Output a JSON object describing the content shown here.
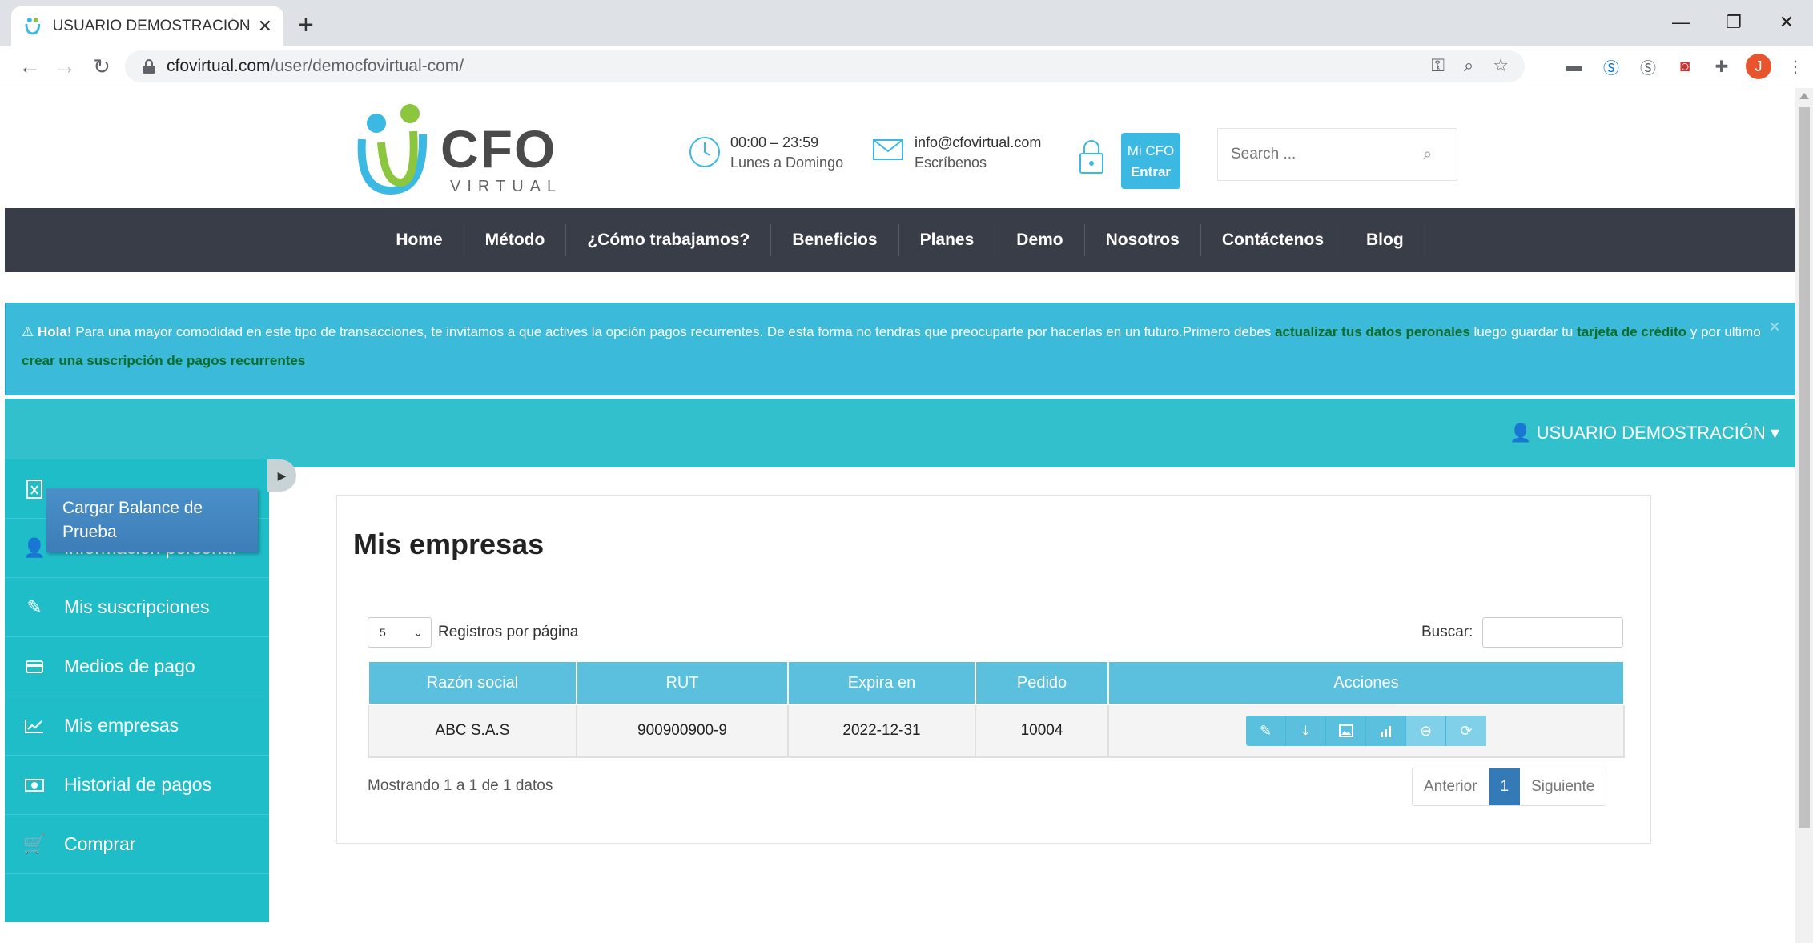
{
  "browser": {
    "tab_title": "USUARIO DEMOSTRACIÓN | CFO",
    "new_tab": "+",
    "url_host": "cfovirtual.com",
    "url_path": "/user/democfovirtual-com/",
    "avatar_letter": "J"
  },
  "site": {
    "logo_text": "CFO",
    "logo_sub": "VIRTUAL",
    "hours": "00:00 – 23:59",
    "days": "Lunes a Domingo",
    "email": "info@cfovirtual.com",
    "email_sub": "Escríbenos",
    "mi_cfo_line1": "Mi CFO",
    "mi_cfo_line2": "Entrar",
    "search_placeholder": "Search ..."
  },
  "nav": [
    "Home",
    "Método",
    "¿Cómo trabajamos?",
    "Beneficios",
    "Planes",
    "Demo",
    "Nosotros",
    "Contáctenos",
    "Blog"
  ],
  "alert": {
    "bold": "Hola!",
    "text1": "Para una mayor comodidad en este tipo de transacciones, te invitamos a que actives la opción pagos recurrentes. De esta forma no tendras que preocuparte por hacerlas en un futuro.Primero debes",
    "link1": "actualizar tus datos peronales",
    "text2": "luego guardar tu",
    "link2": "tarjeta de crédito",
    "text3": "y por ultimo",
    "link3": "crear una suscripción de pagos recurrentes",
    "close": "×"
  },
  "user_bar": {
    "name": "USUARIO DEMOSTRACIÓN"
  },
  "sidebar": {
    "popup": "Cargar Balance de Prueba",
    "items": [
      {
        "label": "Información personal"
      },
      {
        "label": "Mis suscripciones"
      },
      {
        "label": "Medios de pago"
      },
      {
        "label": "Mis empresas"
      },
      {
        "label": "Historial de pagos"
      },
      {
        "label": "Comprar"
      }
    ]
  },
  "main": {
    "title": "Mis empresas",
    "length_value": "5",
    "length_label": "Registros por página",
    "search_label": "Buscar:",
    "columns": [
      "Razón social",
      "RUT",
      "Expira en",
      "Pedido",
      "Acciones"
    ],
    "rows": [
      {
        "razon": "ABC S.A.S",
        "rut": "900900900-9",
        "expira": "2022-12-31",
        "pedido": "10004"
      }
    ],
    "info": "Mostrando 1 a 1 de 1 datos",
    "pager_prev": "Anterior",
    "pager_current": "1",
    "pager_next": "Siguiente"
  },
  "colors": {
    "navbar": "#393d48",
    "alert": "#3cbad9",
    "sidebar": "#1fbdc8",
    "table_header": "#5bc0de",
    "accent": "#337ab7"
  }
}
